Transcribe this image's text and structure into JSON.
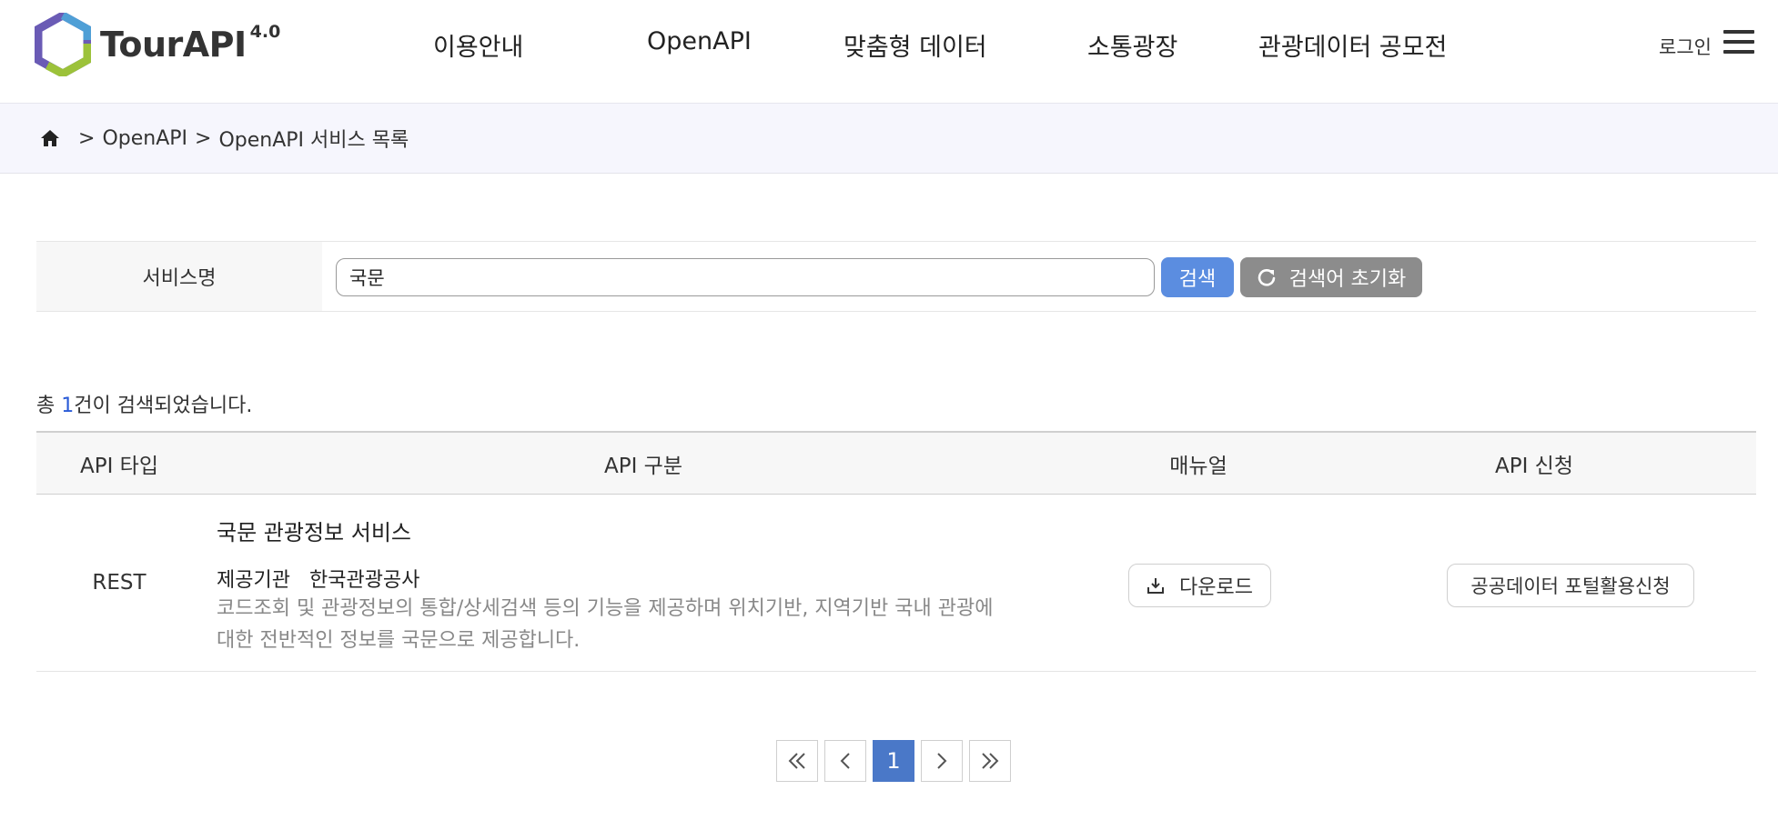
{
  "header": {
    "logo_text": "TourAPI",
    "logo_version": "4.0",
    "nav": [
      "이용안내",
      "OpenAPI",
      "맞춤형 데이터",
      "소통광장",
      "관광데이터 공모전"
    ],
    "login_label": "로그인"
  },
  "breadcrumb": {
    "items": [
      "OpenAPI",
      "OpenAPI 서비스 목록"
    ],
    "separator": ">"
  },
  "search": {
    "label": "서비스명",
    "value": "국문",
    "search_button": "검색",
    "reset_button": "검색어 초기화"
  },
  "result": {
    "prefix": "총 ",
    "count": "1",
    "suffix": "건이 검색되었습니다."
  },
  "table": {
    "headers": [
      "API 타입",
      "API 구분",
      "매뉴얼",
      "API 신청"
    ],
    "rows": [
      {
        "type": "REST",
        "title": "국문 관광정보 서비스",
        "provider_label": "제공기관",
        "provider": "한국관광공사",
        "description_line1": "코드조회 및 관광정보의 통합/상세검색 등의 기능을 제공하며 위치기반, 지역기반 국내 관광에",
        "description_line2": "대한 전반적인 정보를 국문으로 제공합니다.",
        "download_label": "다운로드",
        "apply_label": "공공데이터 포털활용신청"
      }
    ]
  },
  "pagination": {
    "current": "1"
  },
  "colors": {
    "accent_blue": "#5b8de0",
    "page_active": "#4a78c8",
    "reset_gray": "#8c8c8c",
    "breadcrumb_bg": "#f6f6fd"
  }
}
